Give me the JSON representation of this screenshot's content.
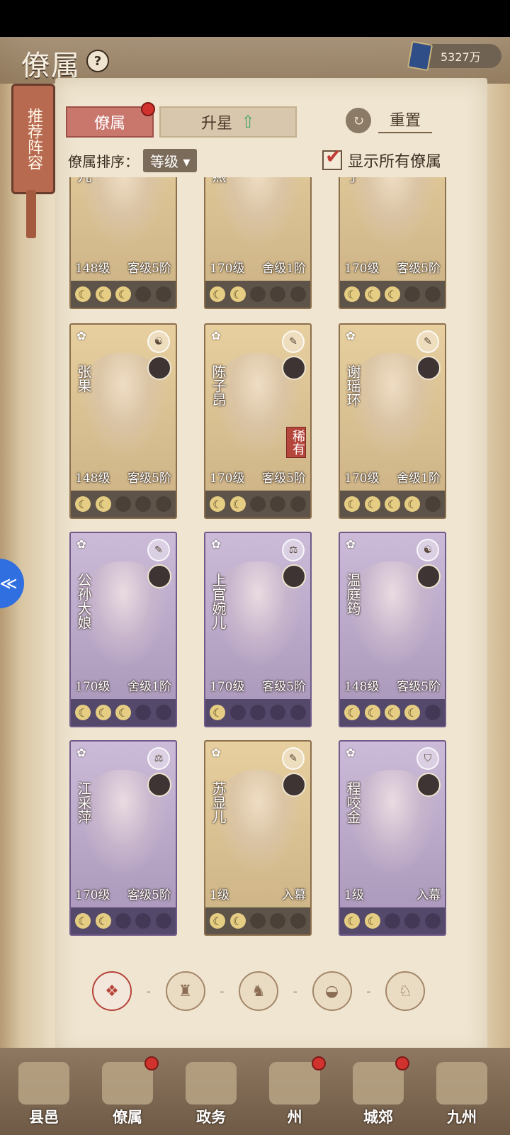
{
  "header": {
    "title": "僚属",
    "currency_value": "5327万"
  },
  "side_banner": {
    "label": "推荐阵容"
  },
  "tabs": {
    "retainers": "僚属",
    "upgrade_star": "升星",
    "reset": "重置"
  },
  "sort": {
    "label": "僚属排序：",
    "value": "等级"
  },
  "show_all": {
    "label": "显示所有僚属",
    "checked": true
  },
  "cards": [
    {
      "name": "婉儿",
      "level": "148级",
      "rank": "客级5阶",
      "moons": [
        1,
        1,
        1,
        0,
        0
      ],
      "color": "tan"
    },
    {
      "name": "飞燕",
      "level": "170级",
      "rank": "舍级1阶",
      "moons": [
        1,
        1,
        0,
        0,
        0
      ],
      "color": "tan"
    },
    {
      "name": "芳宁",
      "level": "170级",
      "rank": "客级5阶",
      "moons": [
        1,
        1,
        1,
        0,
        0
      ],
      "color": "tan"
    },
    {
      "name": "张果",
      "level": "148级",
      "rank": "客级5阶",
      "moons": [
        1,
        1,
        0,
        0,
        0
      ],
      "color": "tan",
      "type_icon": "yin-yang-icon"
    },
    {
      "name": "陈子昂",
      "level": "170级",
      "rank": "客级5阶",
      "moons": [
        1,
        1,
        0,
        0,
        0
      ],
      "color": "tan",
      "type_icon": "brush-icon",
      "rare": "稀有"
    },
    {
      "name": "谢瑶环",
      "level": "170级",
      "rank": "舍级1阶",
      "moons": [
        1,
        1,
        1,
        1,
        0
      ],
      "color": "tan",
      "type_icon": "brush-icon"
    },
    {
      "name": "公孙大娘",
      "level": "170级",
      "rank": "舍级1阶",
      "moons": [
        1,
        1,
        1,
        0,
        0
      ],
      "color": "purple",
      "type_icon": "brush-icon"
    },
    {
      "name": "上官婉儿",
      "level": "170级",
      "rank": "客级5阶",
      "moons": [
        1,
        0,
        0,
        0,
        0
      ],
      "color": "purple",
      "type_icon": "scale-icon"
    },
    {
      "name": "温庭筠",
      "level": "148级",
      "rank": "客级5阶",
      "moons": [
        1,
        1,
        1,
        1,
        0
      ],
      "color": "purple",
      "type_icon": "yin-yang-icon"
    },
    {
      "name": "江采萍",
      "level": "170级",
      "rank": "客级5阶",
      "moons": [
        1,
        1,
        0,
        0,
        0
      ],
      "color": "purple",
      "type_icon": "scale-icon"
    },
    {
      "name": "苏显儿",
      "level": "1级",
      "rank": "入幕",
      "moons": [
        1,
        1,
        0,
        0,
        0
      ],
      "color": "tan",
      "type_icon": "brush-icon"
    },
    {
      "name": "程咬金",
      "level": "1级",
      "rank": "入幕",
      "moons": [
        1,
        1,
        0,
        0,
        0
      ],
      "color": "purple",
      "type_icon": "shield-icon"
    }
  ],
  "filters": [
    "all-icon",
    "official-icon",
    "scholar-icon",
    "fan-icon",
    "beast-icon"
  ],
  "bottom_nav": [
    {
      "label": "县邑",
      "badge": false
    },
    {
      "label": "僚属",
      "badge": true
    },
    {
      "label": "政务",
      "badge": false
    },
    {
      "label": "州",
      "badge": true
    },
    {
      "label": "城郊",
      "badge": true
    },
    {
      "label": "九州",
      "badge": false
    }
  ],
  "colors": {
    "tab_active": "#c9766d",
    "badge_red": "#d2322d",
    "moon_on": "#e5cd83",
    "accent_green": "#4aa56e"
  }
}
